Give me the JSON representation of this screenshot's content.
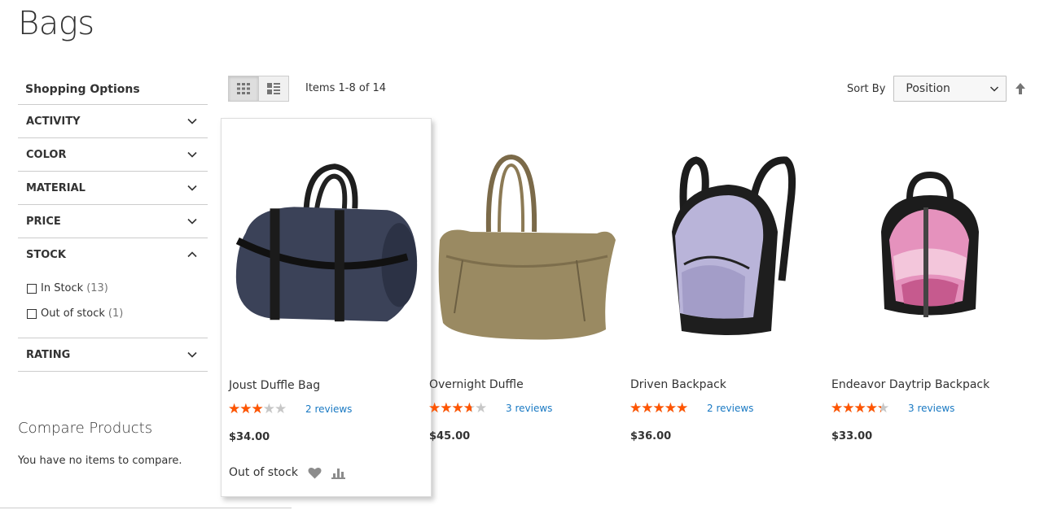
{
  "page": {
    "title": "Bags"
  },
  "sidebar": {
    "title": "Shopping Options",
    "filters": [
      {
        "label": "ACTIVITY"
      },
      {
        "label": "COLOR"
      },
      {
        "label": "MATERIAL"
      },
      {
        "label": "PRICE"
      },
      {
        "label": "STOCK"
      },
      {
        "label": "RATING"
      }
    ],
    "stock_options": [
      {
        "label": "In Stock",
        "count": "(13)"
      },
      {
        "label": "Out of stock",
        "count": "(1)"
      }
    ]
  },
  "compare": {
    "title": "Compare Products",
    "empty": "You have no items to compare."
  },
  "toolbar": {
    "amount": "Items 1-8 of 14",
    "sort_label": "Sort By",
    "sort_value": "Position"
  },
  "products": [
    {
      "name": "Joust Duffle Bag",
      "rating": 0.5,
      "reviews": "2 reviews",
      "price": "$34.00",
      "stock": "Out of stock"
    },
    {
      "name": "Overnight Duffle",
      "rating": 0.6,
      "reviews": "3 reviews",
      "price": "$45.00"
    },
    {
      "name": "Driven Backpack",
      "rating": 0.9,
      "reviews": "2 reviews",
      "price": "$36.00"
    },
    {
      "name": "Endeavor Daytrip Backpack",
      "rating": 0.7,
      "reviews": "3 reviews",
      "price": "$33.00"
    }
  ],
  "colors": {
    "star": "#ff5501",
    "star_empty": "#c7c7c7",
    "link": "#1979c3"
  }
}
